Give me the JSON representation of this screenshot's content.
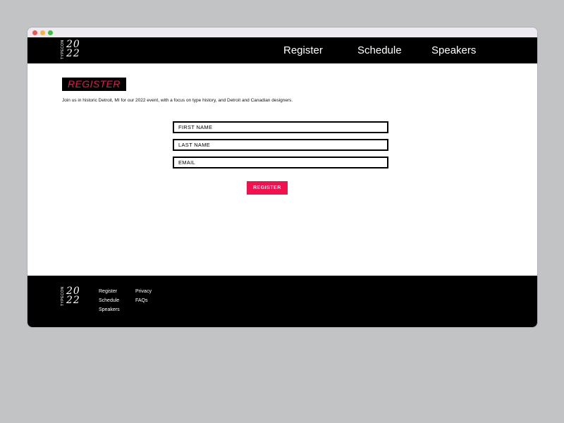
{
  "brand": {
    "side_text": "TYPECON",
    "year_top": "20",
    "year_bottom": "22"
  },
  "colors": {
    "accent": "#f3104e",
    "header_bg": "#000000",
    "page_bg": "#c2c3c5",
    "chrome_bg": "#efeaf1",
    "dot_red": "#f0564f",
    "dot_yellow": "#f5b53a",
    "dot_green": "#37c23a"
  },
  "nav": {
    "items": [
      {
        "label": "Register"
      },
      {
        "label": "Schedule"
      },
      {
        "label": "Speakers"
      }
    ]
  },
  "main": {
    "title": "REGISTER",
    "intro": "Join us in historic Detroit, MI for our 2022 event, with a focus on type history, and Detroit and Canadian designers.",
    "form": {
      "first_name_placeholder": "FIRST NAME",
      "last_name_placeholder": "LAST NAME",
      "email_placeholder": "EMAIL",
      "submit_label": "REGISTER"
    }
  },
  "footer": {
    "col1": [
      {
        "label": "Register"
      },
      {
        "label": "Schedule"
      },
      {
        "label": "Speakers"
      }
    ],
    "col2": [
      {
        "label": "Privacy"
      },
      {
        "label": "FAQs"
      }
    ]
  }
}
